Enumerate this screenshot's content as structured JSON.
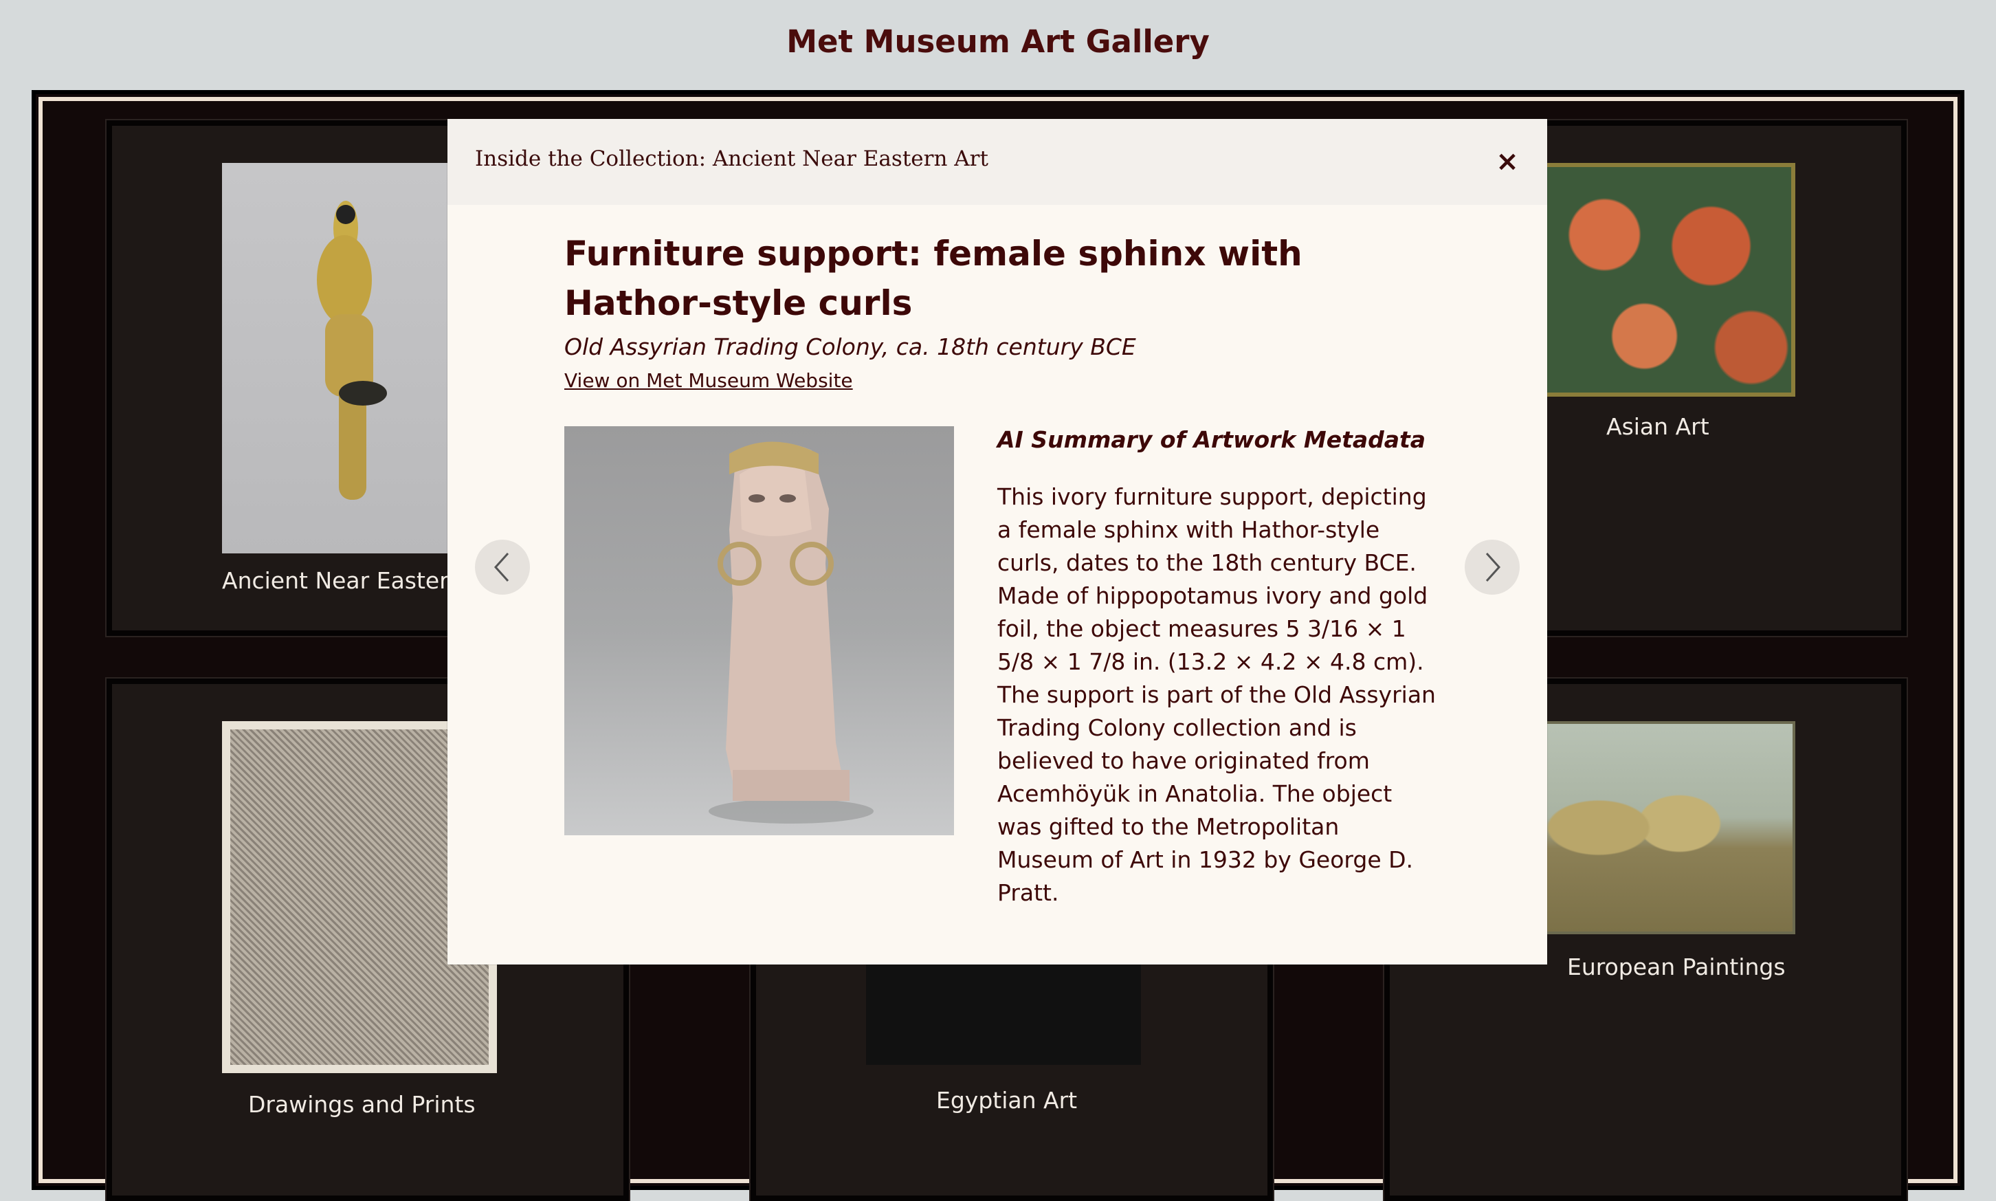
{
  "page": {
    "title": "Met Museum Art Gallery"
  },
  "gallery": {
    "departments": [
      {
        "label": "Ancient Near Eastern Art"
      },
      {
        "label": "Asian Art"
      },
      {
        "label": "Drawings and Prints"
      },
      {
        "label": "Egyptian Art"
      },
      {
        "label": "European Paintings"
      }
    ]
  },
  "modal": {
    "header_title": "Inside the Collection: Ancient Near Eastern Art",
    "close_label": "×",
    "artwork": {
      "title": "Furniture support: female sphinx with Hathor-style curls",
      "subtitle": "Old Assyrian Trading Colony, ca. 18th century BCE",
      "link_text": "View on Met Museum Website"
    },
    "summary": {
      "heading": "AI Summary of Artwork Metadata",
      "text": "This ivory furniture support, depicting a female sphinx with Hathor-style curls, dates to the 18th century BCE. Made of hippopotamus ivory and gold foil, the object measures 5 3/16 × 1 5/8 × 1 7/8 in. (13.2 × 4.2 × 4.8 cm). The support is part of the Old Assyrian Trading Colony collection and is believed to have originated from Acemhöyük in Anatolia. The object was gifted to the Metropolitan Museum of Art in 1932 by George D. Pratt."
    },
    "nav": {
      "prev_icon": "chevron-left-icon",
      "next_icon": "chevron-right-icon"
    }
  },
  "colors": {
    "page_bg": "#d6dadb",
    "title": "#4a0c0c",
    "gallery_bg": "#120909",
    "panel_bg": "#1e1816",
    "modal_bg": "#fcf8f2",
    "modal_header_bg": "#f3f0ec"
  }
}
